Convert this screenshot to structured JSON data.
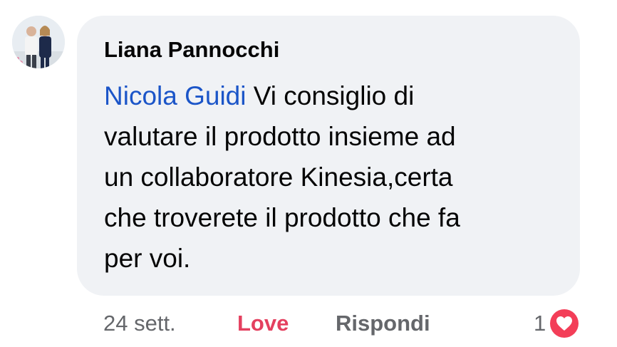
{
  "comment": {
    "author": "Liana Pannocchi",
    "mention": "Nicola Guidi",
    "text_lines": [
      " Vi consiglio di",
      "valutare il prodotto insieme ad",
      "un collaboratore Kinesia,certa",
      "che troverete il prodotto che fa",
      "per voi."
    ]
  },
  "actions": {
    "timestamp": "24 sett.",
    "love_label": "Love",
    "reply_label": "Rispondi"
  },
  "reactions": {
    "count": "1",
    "icon": "heart-icon"
  },
  "colors": {
    "bubble": "#f0f2f5",
    "mention": "#1b55c8",
    "love": "#e4405f",
    "meta": "#65676b",
    "heart": "#f33e58"
  }
}
